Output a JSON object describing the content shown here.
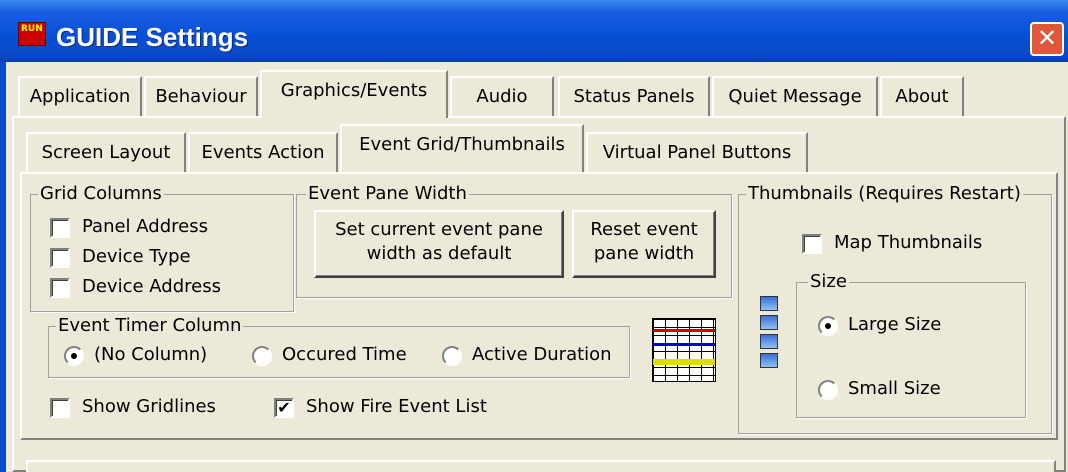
{
  "window": {
    "title": "GUIDE Settings",
    "icon": "run-app-icon",
    "close_glyph": "✕"
  },
  "main_tabs": [
    {
      "label": "Application"
    },
    {
      "label": "Behaviour"
    },
    {
      "label": "Graphics/Events",
      "active": true
    },
    {
      "label": "Audio"
    },
    {
      "label": "Status Panels"
    },
    {
      "label": "Quiet Message"
    },
    {
      "label": "About"
    }
  ],
  "sub_tabs": [
    {
      "label": "Screen Layout"
    },
    {
      "label": "Events Action"
    },
    {
      "label": "Event Grid/Thumbnails",
      "active": true
    },
    {
      "label": "Virtual Panel Buttons"
    }
  ],
  "grid_columns": {
    "legend": "Grid Columns",
    "items": [
      {
        "label": "Panel Address",
        "checked": false
      },
      {
        "label": "Device Type",
        "checked": false
      },
      {
        "label": "Device Address",
        "checked": false
      }
    ]
  },
  "event_pane_width": {
    "legend": "Event Pane Width",
    "set_default_line1": "Set current event pane",
    "set_default_line2": "width as default",
    "reset_line1": "Reset event",
    "reset_line2": "pane width"
  },
  "event_timer_column": {
    "legend": "Event Timer Column",
    "options": [
      {
        "label": "(No Column)",
        "selected": true
      },
      {
        "label": "Occured Time",
        "selected": false
      },
      {
        "label": "Active Duration",
        "selected": false
      }
    ]
  },
  "show_gridlines": {
    "label": "Show Gridlines",
    "checked": false
  },
  "show_fire_event_list": {
    "label": "Show Fire Event List",
    "checked": true,
    "check_glyph": "✔"
  },
  "thumbnails": {
    "legend": "Thumbnails (Requires Restart)",
    "map_thumbnails": {
      "label": "Map Thumbnails",
      "checked": false
    },
    "size_legend": "Size",
    "size_options": [
      {
        "label": "Large Size",
        "selected": true
      },
      {
        "label": "Small Size",
        "selected": false
      }
    ]
  },
  "colors": {
    "face": "#ece9d8",
    "titlebar": "#0a4bc8",
    "close": "#e0573b"
  }
}
